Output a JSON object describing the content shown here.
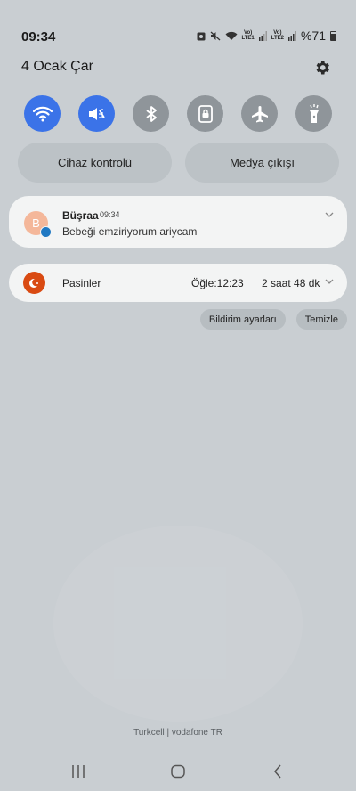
{
  "status_bar": {
    "time": "09:34",
    "sim1_label": "Vo)) LTE1",
    "sim2_label": "Vo)) LTE2",
    "battery": "%71"
  },
  "header": {
    "date": "4 Ocak Çar"
  },
  "quick_settings": [
    {
      "name": "wifi",
      "state": "on",
      "color": "#3b73e8"
    },
    {
      "name": "mute",
      "state": "on",
      "color": "#3b73e8"
    },
    {
      "name": "bluetooth",
      "state": "off",
      "color": "#8f959a"
    },
    {
      "name": "rotation-lock",
      "state": "off",
      "color": "#8f959a"
    },
    {
      "name": "airplane",
      "state": "off",
      "color": "#8f959a"
    },
    {
      "name": "flashlight",
      "state": "off",
      "color": "#8f959a"
    }
  ],
  "pills": {
    "device_control": "Cihaz kontrolü",
    "media_output": "Medya çıkışı"
  },
  "notifications": {
    "message": {
      "avatar_letter": "B",
      "sender": "Büşraa",
      "time": "09:34",
      "body": "Bebeği emziriyorum ariycam"
    },
    "prayer": {
      "app": "Pasinler",
      "next_prayer": "Öğle:12:23",
      "remaining": "2 saat 48 dk"
    }
  },
  "actions": {
    "settings": "Bildirim ayarları",
    "clear": "Temizle"
  },
  "carrier": "Turkcell | vodafone TR"
}
